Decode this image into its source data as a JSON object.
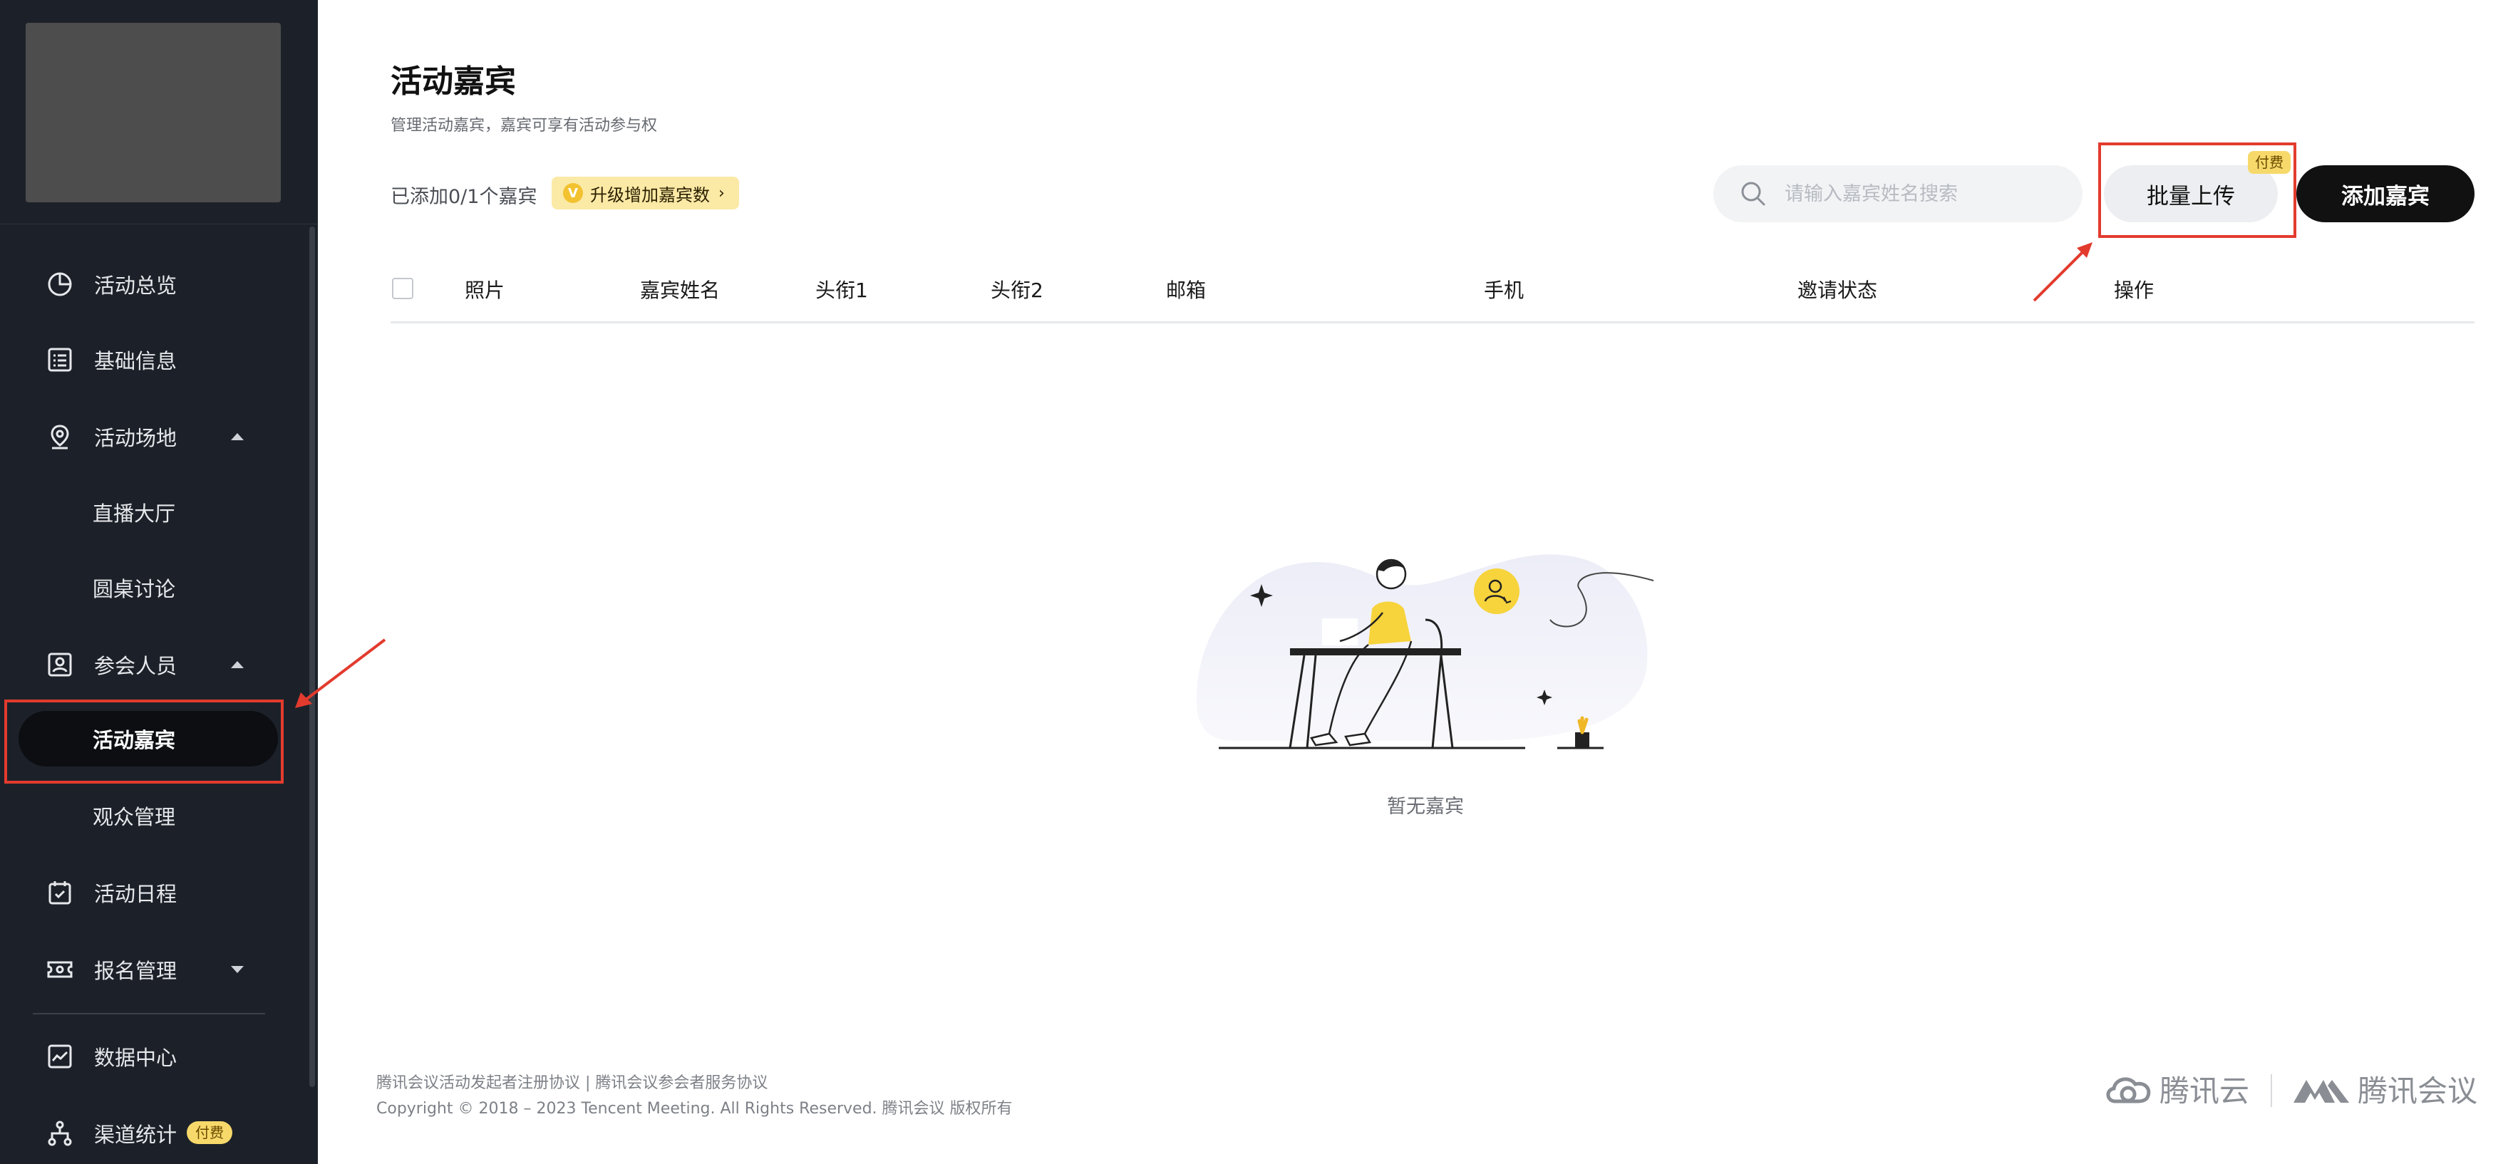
{
  "sidebar": {
    "items": [
      {
        "label": "活动总览",
        "icon": "pie-chart-icon"
      },
      {
        "label": "基础信息",
        "icon": "document-list-icon"
      },
      {
        "label": "活动场地",
        "icon": "location-pin-icon",
        "expanded": true
      },
      {
        "label": "直播大厅"
      },
      {
        "label": "圆桌讨论"
      },
      {
        "label": "参会人员",
        "icon": "attendee-badge-icon",
        "expanded": true
      },
      {
        "label": "活动嘉宾",
        "active": true
      },
      {
        "label": "观众管理"
      },
      {
        "label": "活动日程",
        "icon": "calendar-check-icon"
      },
      {
        "label": "报名管理",
        "icon": "ticket-icon",
        "expanded": false
      },
      {
        "label": "数据中心",
        "icon": "line-chart-icon"
      },
      {
        "label": "渠道统计",
        "icon": "channel-tree-icon",
        "badge": "付费"
      }
    ]
  },
  "header": {
    "title": "活动嘉宾",
    "subtitle": "管理活动嘉宾，嘉宾可享有活动参与权"
  },
  "toolbar": {
    "count_text": "已添加0/1个嘉宾",
    "upgrade_label": "升级增加嘉宾数",
    "upgrade_badge": "V",
    "search_placeholder": "请输入嘉宾姓名搜索",
    "batch_upload_label": "批量上传",
    "fee_tag": "付费",
    "add_guest_label": "添加嘉宾"
  },
  "table": {
    "columns": [
      "照片",
      "嘉宾姓名",
      "头衔1",
      "头衔2",
      "邮箱",
      "手机",
      "邀请状态",
      "操作"
    ]
  },
  "empty": {
    "text": "暂无嘉宾"
  },
  "footer": {
    "links": "腾讯会议活动发起者注册协议 | 腾讯会议参会者服务协议",
    "copyright": "Copyright © 2018 – 2023 Tencent Meeting. All Rights Reserved. 腾讯会议 版权所有",
    "brand_cloud": "腾讯云",
    "brand_meeting": "腾讯会议"
  },
  "colors": {
    "sidebar_bg": "#1c2129",
    "accent_black": "#111111",
    "highlight_yellow": "#f6d96a",
    "annotation_red": "#e23b2e"
  }
}
